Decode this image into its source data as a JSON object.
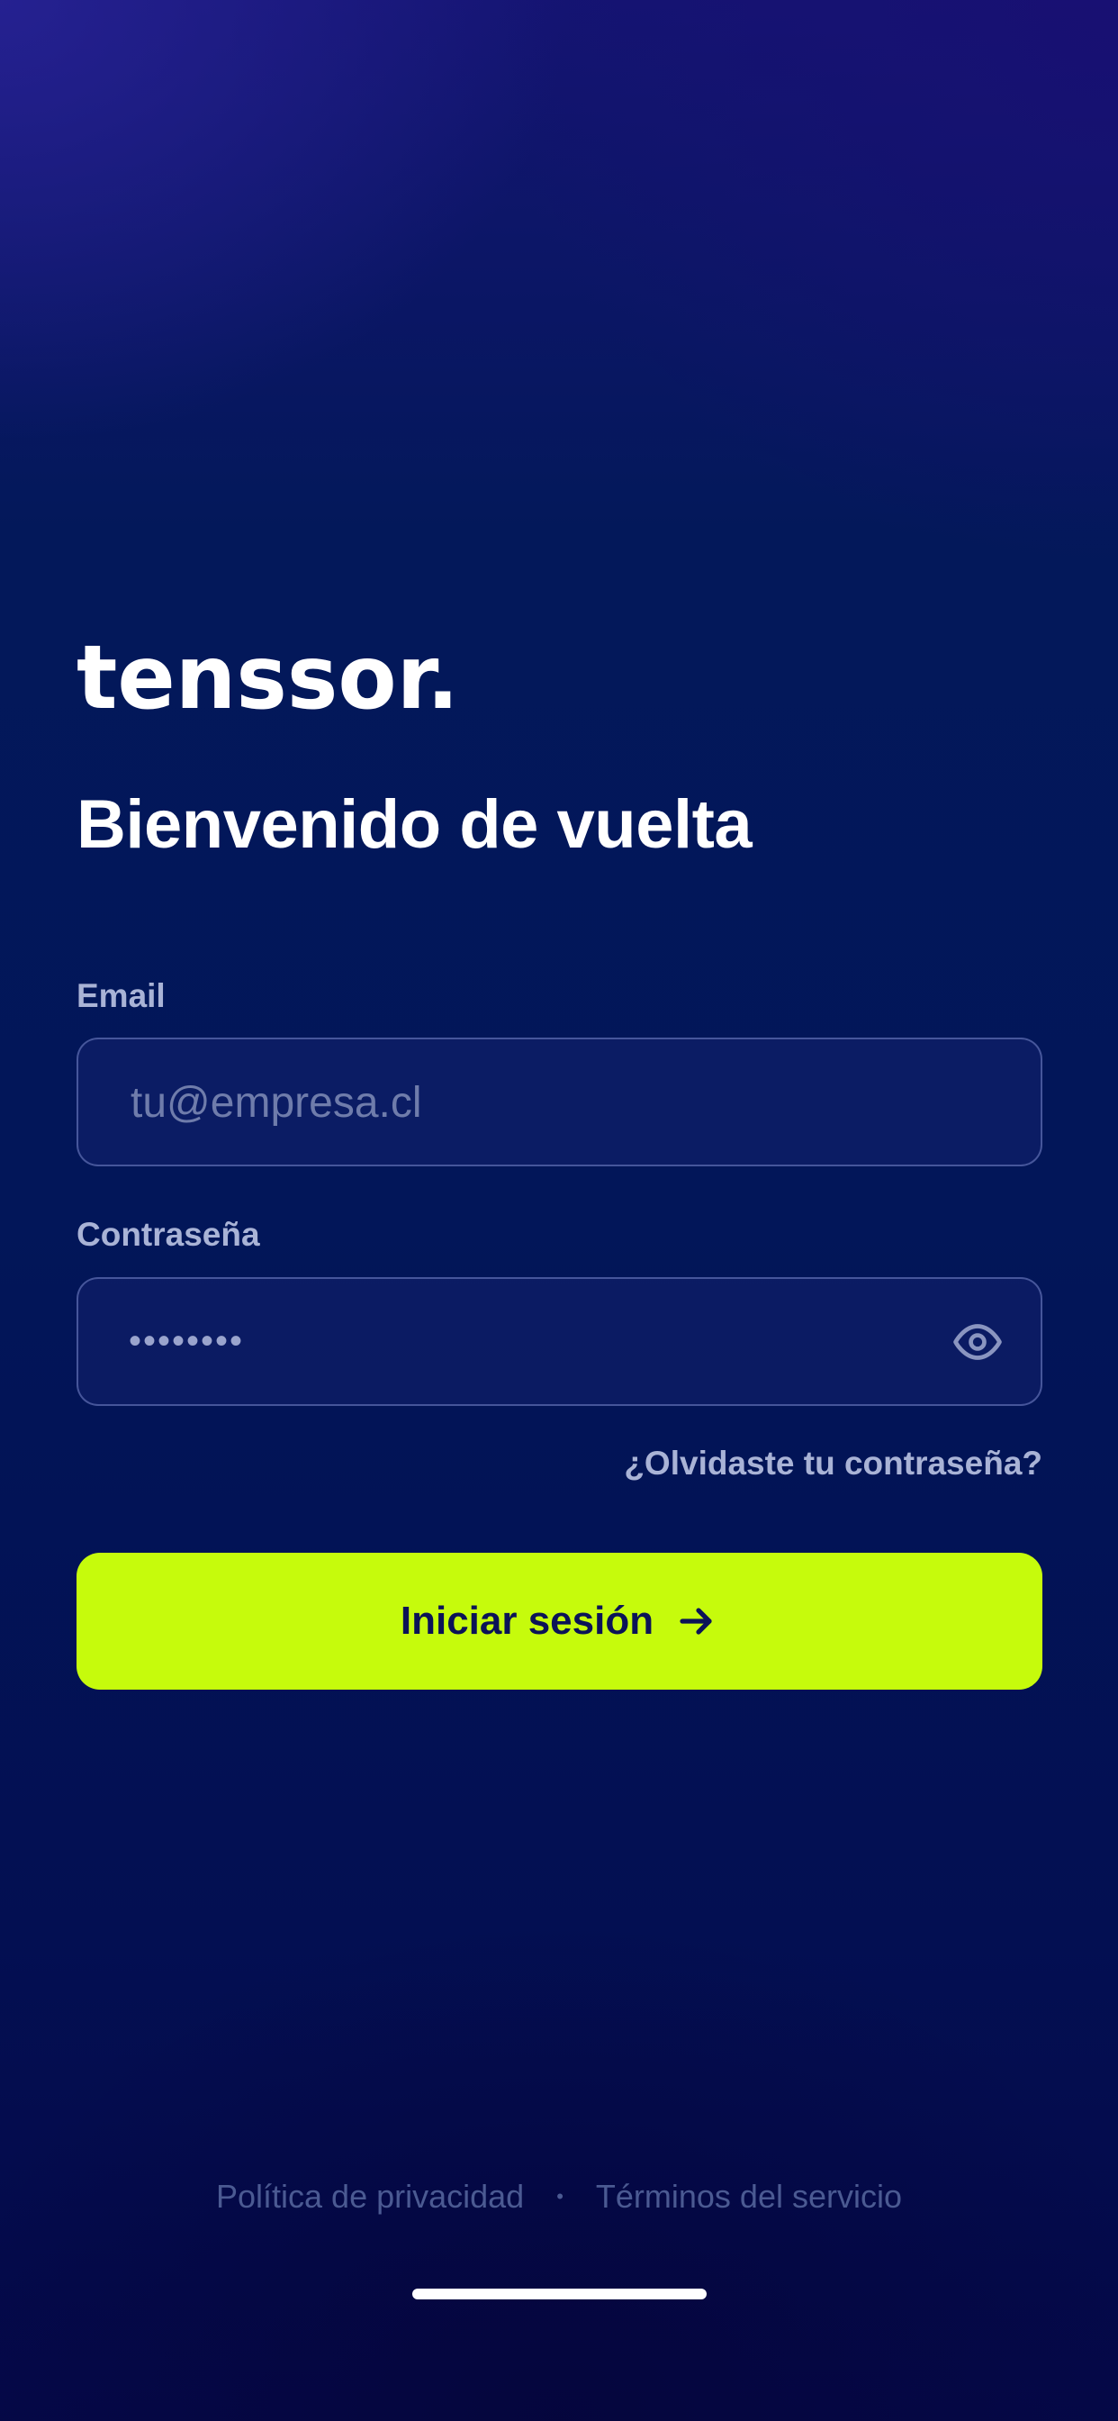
{
  "brand": {
    "logo_text": "tenssor."
  },
  "login": {
    "title": "Bienvenido de vuelta",
    "email": {
      "label": "Email",
      "placeholder": "tu@empresa.cl",
      "value": ""
    },
    "password": {
      "label": "Contraseña",
      "masked_value": "••••••••",
      "toggle_icon": "eye-icon"
    },
    "forgot_link": "¿Olvidaste tu contraseña?",
    "submit": {
      "label": "Iniciar sesión",
      "icon": "arrow-right-icon"
    }
  },
  "footer": {
    "privacy": "Política de privacidad",
    "separator": "•",
    "terms": "Términos del servicio"
  },
  "colors": {
    "accent": "#c6fb0c",
    "background_top": "#141472",
    "background_main": "#021659",
    "text_muted": "#a9b3d6"
  }
}
